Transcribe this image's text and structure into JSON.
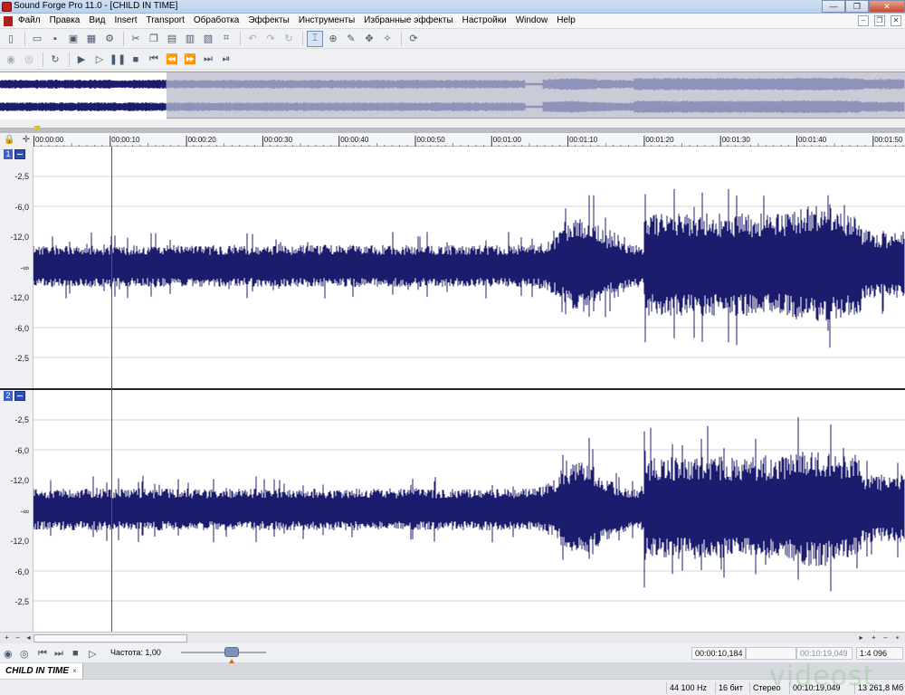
{
  "window": {
    "title": "Sound Forge Pro 11.0 - [CHILD IN TIME]",
    "controls": {
      "minimize": "—",
      "maximize": "❐",
      "close": "✕"
    }
  },
  "menubar": {
    "items": [
      "Файл",
      "Правка",
      "Вид",
      "Insert",
      "Transport",
      "Обработка",
      "Эффекты",
      "Инструменты",
      "Избранные эффекты",
      "Настройки",
      "Window",
      "Help"
    ],
    "mdi": {
      "minimize": "–",
      "restore": "❐",
      "close": "✕"
    }
  },
  "toolbar_main": {
    "icons": [
      "new-file",
      "open-file",
      "save",
      "save-as",
      "render",
      "properties",
      "cut",
      "copy",
      "paste",
      "paste-special",
      "mix",
      "crop",
      "undo",
      "redo",
      "repeat",
      "edit-tool",
      "magnify-tool",
      "pencil-tool",
      "event-tool",
      "envelope-tool",
      "loop-tool"
    ]
  },
  "toolbar_transport": {
    "icons": [
      "record",
      "monitor",
      "loop",
      "play-all",
      "play",
      "pause",
      "stop",
      "go-to-start",
      "rewind",
      "fast-forward",
      "go-to-end",
      "skip-end"
    ]
  },
  "timeline": {
    "ticks": [
      "00:00:00",
      "00:00:10",
      "00:00:20",
      "00:00:30",
      "00:00:40",
      "00:00:50",
      "00:01:00",
      "00:01:10",
      "00:01:20",
      "00:01:30",
      "00:01:40",
      "00:01:50"
    ]
  },
  "channels": [
    {
      "number": "1",
      "db_labels": [
        "-2,5",
        "-6,0",
        "-12,0",
        "-∞",
        "-12,0",
        "-6,0",
        "-2,5"
      ]
    },
    {
      "number": "2",
      "db_labels": [
        "-2,5",
        "-6,0",
        "-12,0",
        "-∞",
        "-12,0",
        "-6,0",
        "-2,5"
      ]
    }
  ],
  "wave_color": "#1c1c6e",
  "overview_colors": {
    "selected": "#1c1c6e",
    "rest": "#8f93ba"
  },
  "transport_bar": {
    "rate_label": "Частота: 1,00",
    "cursor_position": "00:00:10,184",
    "selection_field": "",
    "length_field": "00:10:19,049",
    "zoom_ratio": "1:4 096"
  },
  "document_tab": {
    "label": "CHILD IN TIME",
    "close": "×"
  },
  "statusbar": {
    "sample_rate": "44 100 Hz",
    "bit_depth": "16 бит",
    "channels": "Стерео",
    "length": "00:10:19,049",
    "disk_space": "13 261,8 Мб"
  },
  "watermark": "videost"
}
